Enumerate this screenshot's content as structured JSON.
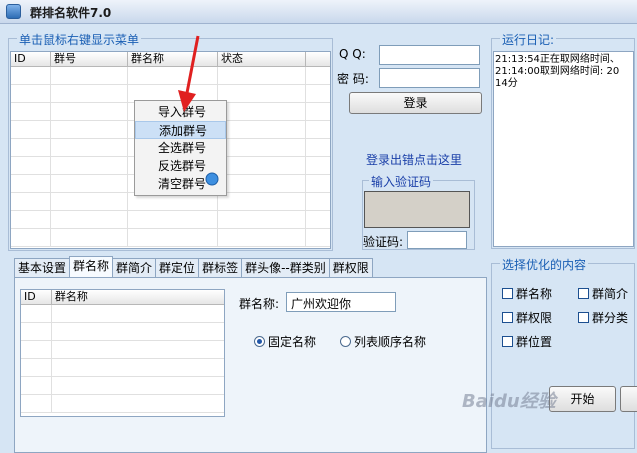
{
  "window": {
    "title": "群排名软件7.0"
  },
  "left_group": {
    "title": "单击鼠标右键显示菜单",
    "columns": [
      "ID",
      "群号",
      "群名称",
      "状态"
    ]
  },
  "context_menu": {
    "items": [
      "导入群号",
      "添加群号",
      "全选群号",
      "反选群号",
      "清空群号"
    ],
    "hovered_index": 1
  },
  "login": {
    "qq_label": "Q    Q:",
    "password_label": "密    码:",
    "qq_value": "",
    "password_value": "",
    "login_button": "登录",
    "error_link": "登录出错点击这里",
    "captcha_group_title": "输入验证码",
    "captcha_label": "验证码:",
    "captcha_value": ""
  },
  "log": {
    "title": "运行日记:",
    "lines": [
      "21:13:54正在取网络时间、",
      "21:14:00取到网络时间: 20",
      "14分"
    ]
  },
  "tabs": [
    "基本设置",
    "群名称",
    "群简介",
    "群定位",
    "群标签",
    "群头像--群类别",
    "群权限"
  ],
  "active_tab_index": 1,
  "name_tab": {
    "columns": [
      "ID",
      "群名称"
    ],
    "name_label": "群名称:",
    "name_value": "广州欢迎你",
    "radio_fixed": "固定名称",
    "radio_list": "列表顺序名称",
    "selected_radio": "fixed"
  },
  "optimize": {
    "title": "选择优化的内容",
    "checkboxes": [
      "群名称",
      "群简介",
      "群权限",
      "群分类",
      "群位置"
    ],
    "start_button": "开始"
  },
  "watermark": "Baidu经验"
}
